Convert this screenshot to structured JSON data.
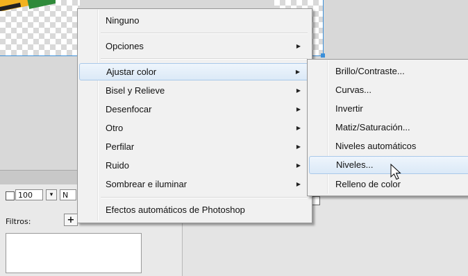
{
  "background": {
    "size_value": "100",
    "size_dropdown_glyph": "▾",
    "mode_partial": "N",
    "filters_label": "Filtros:",
    "add_filter_glyph": "+"
  },
  "main_menu": {
    "items": [
      {
        "label": "Ninguno",
        "has_submenu": false
      },
      {
        "label": "Opciones",
        "has_submenu": true
      },
      {
        "label": "Ajustar color",
        "has_submenu": true,
        "highlighted": true
      },
      {
        "label": "Bisel y Relieve",
        "has_submenu": true
      },
      {
        "label": "Desenfocar",
        "has_submenu": true
      },
      {
        "label": "Otro",
        "has_submenu": true
      },
      {
        "label": "Perfilar",
        "has_submenu": true
      },
      {
        "label": "Ruido",
        "has_submenu": true
      },
      {
        "label": "Sombrear e iluminar",
        "has_submenu": true
      },
      {
        "label": "Efectos automáticos de Photoshop",
        "has_submenu": false
      }
    ],
    "arrow_glyph": "▶"
  },
  "sub_menu": {
    "items": [
      {
        "label": "Brillo/Contraste..."
      },
      {
        "label": "Curvas..."
      },
      {
        "label": "Invertir"
      },
      {
        "label": "Matiz/Saturación..."
      },
      {
        "label": "Niveles automáticos"
      },
      {
        "label": "Niveles...",
        "highlighted": true
      },
      {
        "label": "Relleno de color"
      }
    ]
  },
  "colors": {
    "highlight_border": "#a9c9ea",
    "selection_line": "#3b8fd9"
  },
  "icons": {
    "cursor": "arrow-pointer-icon"
  }
}
